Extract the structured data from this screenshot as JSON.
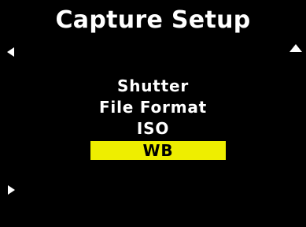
{
  "screen": {
    "title": "Capture Setup"
  },
  "colors": {
    "background": "#000000",
    "text": "#ffffff",
    "highlight": "#eeee00",
    "highlight_text": "#000000"
  },
  "nav": {
    "left_icon": "chevron-left-icon",
    "right_icon": "chevron-right-icon",
    "up_icon": "chevron-up-icon"
  },
  "menu": {
    "items": [
      {
        "label": "Shutter",
        "selected": false
      },
      {
        "label": "File Format",
        "selected": false
      },
      {
        "label": "ISO",
        "selected": false
      },
      {
        "label": "WB",
        "selected": true
      }
    ]
  }
}
